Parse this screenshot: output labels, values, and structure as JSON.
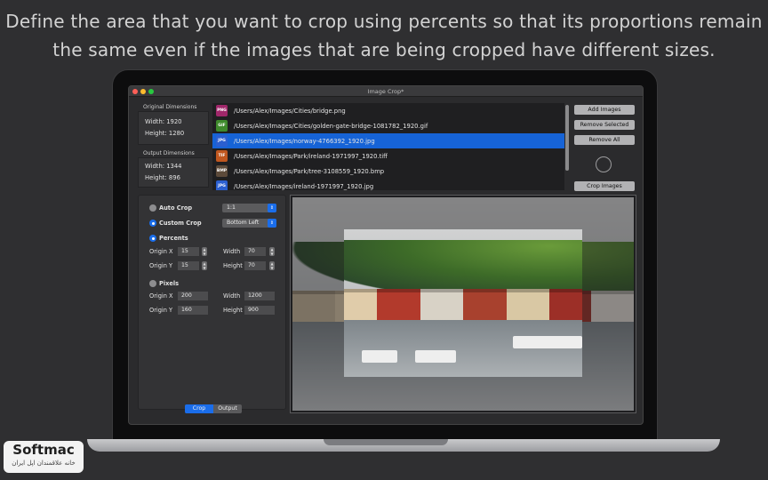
{
  "headline": {
    "line1": "Define the area that you want to crop using percents so that its proportions remain",
    "line2": "the same even if the images that are being cropped have different sizes."
  },
  "window": {
    "title": "Image Crop*"
  },
  "original_dimensions": {
    "heading": "Original Dimensions",
    "width": "Width: 1920",
    "height": "Height: 1280"
  },
  "output_dimensions": {
    "heading": "Output Dimensions",
    "width": "Width: 1344",
    "height": "Height: 896"
  },
  "files": [
    {
      "type": "PNG",
      "color": "#a0276a",
      "path": "/Users/Alex/Images/Cities/bridge.png",
      "selected": false
    },
    {
      "type": "GIF",
      "color": "#3f8a2c",
      "path": "/Users/Alex/Images/Cities/golden-gate-bridge-1081782_1920.gif",
      "selected": false
    },
    {
      "type": "JPG",
      "color": "#2b5fd0",
      "path": "/Users/Alex/Images/norway-4766392_1920.jpg",
      "selected": true
    },
    {
      "type": "TIF",
      "color": "#c0571f",
      "path": "/Users/Alex/Images/Park/ireland-1971997_1920.tiff",
      "selected": false
    },
    {
      "type": "BMP",
      "color": "#5c4a3a",
      "path": "/Users/Alex/Images/Park/tree-3108559_1920.bmp",
      "selected": false
    },
    {
      "type": "JPG",
      "color": "#2b5fd0",
      "path": "/Users/Alex/Images/ireland-1971997_1920.jpg",
      "selected": false
    }
  ],
  "side_buttons": {
    "add": "Add Images",
    "remove_selected": "Remove Selected",
    "remove_all": "Remove All",
    "crop": "Crop Images"
  },
  "crop_panel": {
    "auto_crop": "Auto Crop",
    "auto_crop_value": "1:1",
    "custom_crop": "Custom Crop",
    "custom_crop_value": "Bottom Left",
    "percents": "Percents",
    "pixels": "Pixels",
    "origin_x": "Origin X",
    "origin_y": "Origin Y",
    "width": "Width",
    "height": "Height",
    "pct_origin_x": "15",
    "pct_origin_y": "15",
    "pct_width": "70",
    "pct_height": "70",
    "px_origin_x": "200",
    "px_origin_y": "160",
    "px_width": "1200",
    "px_height": "900",
    "tab_crop": "Crop",
    "tab_output": "Output"
  },
  "watermark": {
    "brand": "Softmac",
    "tagline": "خانه علاقمندان اپل ایران"
  }
}
